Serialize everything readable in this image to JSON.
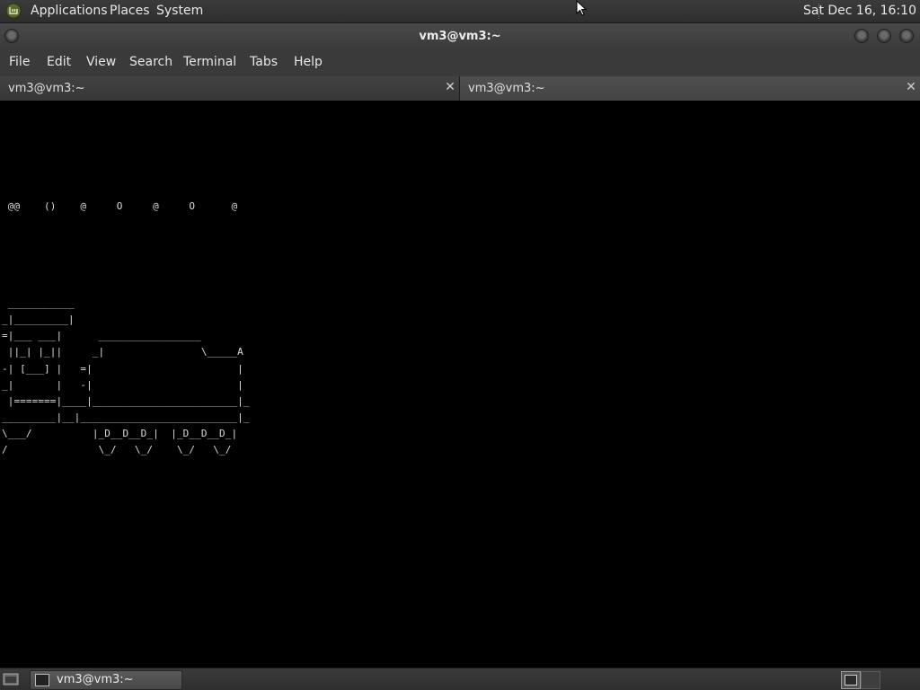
{
  "top_panel": {
    "menus": [
      "Applications",
      "Places",
      "System"
    ],
    "clock": "Sat Dec 16, 16:10",
    "logo_icon": "mint-logo-icon"
  },
  "window": {
    "title": "vm3@vm3:~"
  },
  "menubar": {
    "items": [
      "File",
      "Edit",
      "View",
      "Search",
      "Terminal",
      "Tabs",
      "Help"
    ]
  },
  "tabs": [
    {
      "label": "vm3@vm3:~",
      "close": "✕"
    },
    {
      "label": "vm3@vm3:~",
      "close": "✕"
    }
  ],
  "terminal": {
    "text": "\n\n\n\n\n\n @@    ()    @     O     @     O      @\n\n\n\n\n\n ___________\n_|_________|\n=|___ ___|      _________________\n ||_| |_||     _|                \\_____A\n-| [___] |   =|                        |\n_|       |   -|                        |\n |=======|____|________________________|_\n_________|__|__________________________|_\n\\___/          |_D__D__D_|  |_D__D__D_|\n/               \\_/   \\_/    \\_/   \\_/"
  },
  "taskbar": {
    "task_label": "vm3@vm3:~"
  },
  "colors": {
    "panel": "#2e2e2e",
    "terminal_bg": "#000000",
    "terminal_fg": "#dcdcdc"
  }
}
